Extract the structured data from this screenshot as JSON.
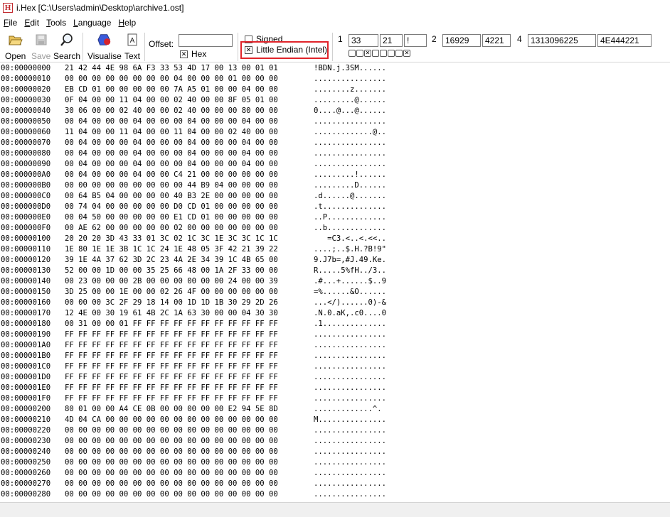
{
  "window": {
    "title": "i.Hex [C:\\Users\\admin\\Desktop\\archive1.ost]",
    "icon_letter": "H"
  },
  "menu": [
    {
      "label": "File",
      "underline": "F",
      "rest": "ile"
    },
    {
      "label": "Edit",
      "underline": "E",
      "rest": "dit"
    },
    {
      "label": "Tools",
      "underline": "T",
      "rest": "ools"
    },
    {
      "label": "Language",
      "underline": "L",
      "rest": "anguage"
    },
    {
      "label": "Help",
      "underline": "H",
      "rest": "elp"
    }
  ],
  "toolbar": {
    "open_label": "Open",
    "save_label": "Save",
    "search_label": "Search",
    "visualise_label": "Visualise",
    "text_label": "Text",
    "offset_label": "Offset:",
    "offset_value": "",
    "hex_label": "Hex",
    "hex_checked": true,
    "signed_label": "Signed",
    "signed_checked": false,
    "little_endian_label": "Little Endian (Intel)",
    "little_endian_checked": true
  },
  "inspector": {
    "group1_num": "1",
    "group1_values": [
      "33",
      "21",
      "!"
    ],
    "group2_num": "2",
    "group2_values": [
      "16929",
      "4221"
    ],
    "group4_num": "4",
    "group4_values": [
      "1313096225",
      "4E444221"
    ],
    "bits": [
      false,
      false,
      true,
      false,
      false,
      false,
      false,
      true
    ]
  },
  "colors": {
    "highlight": "#e0242a",
    "icon_red": "#c0282d"
  },
  "rows": [
    {
      "addr": "00:00000000",
      "bytes": "21 42 44 4E 98 6A F3 33 53 4D 17 00 13 00 01 01",
      "ascii": "!BDN.j.3SM......"
    },
    {
      "addr": "00:00000010",
      "bytes": "00 00 00 00 00 00 00 00 04 00 00 00 01 00 00 00",
      "ascii": "................"
    },
    {
      "addr": "00:00000020",
      "bytes": "EB CD 01 00 00 00 00 00 7A A5 01 00 00 04 00 00",
      "ascii": "........z......."
    },
    {
      "addr": "00:00000030",
      "bytes": "0F 04 00 00 11 04 00 00 02 40 00 00 8F 05 01 00",
      "ascii": ".........@......"
    },
    {
      "addr": "00:00000040",
      "bytes": "30 06 00 00 02 40 00 00 02 40 00 00 00 80 00 00",
      "ascii": "0....@...@......"
    },
    {
      "addr": "00:00000050",
      "bytes": "00 04 00 00 00 04 00 00 00 04 00 00 00 04 00 00",
      "ascii": "................"
    },
    {
      "addr": "00:00000060",
      "bytes": "11 04 00 00 11 04 00 00 11 04 00 00 02 40 00 00",
      "ascii": ".............@.."
    },
    {
      "addr": "00:00000070",
      "bytes": "00 04 00 00 00 04 00 00 00 04 00 00 00 04 00 00",
      "ascii": "................"
    },
    {
      "addr": "00:00000080",
      "bytes": "00 04 00 00 00 04 00 00 00 04 00 00 00 04 00 00",
      "ascii": "................"
    },
    {
      "addr": "00:00000090",
      "bytes": "00 04 00 00 00 04 00 00 00 04 00 00 00 04 00 00",
      "ascii": "................"
    },
    {
      "addr": "00:000000A0",
      "bytes": "00 04 00 00 00 04 00 00 C4 21 00 00 00 00 00 00",
      "ascii": ".........!......"
    },
    {
      "addr": "00:000000B0",
      "bytes": "00 00 00 00 00 00 00 00 00 44 B9 04 00 00 00 00",
      "ascii": ".........D......"
    },
    {
      "addr": "00:000000C0",
      "bytes": "00 64 B5 04 00 00 00 00 40 B3 2E 00 00 00 00 00",
      "ascii": ".d......@......."
    },
    {
      "addr": "00:000000D0",
      "bytes": "00 74 04 00 00 00 00 00 D0 CD 01 00 00 00 00 00",
      "ascii": ".t.............."
    },
    {
      "addr": "00:000000E0",
      "bytes": "00 04 50 00 00 00 00 00 E1 CD 01 00 00 00 00 00",
      "ascii": "..P............."
    },
    {
      "addr": "00:000000F0",
      "bytes": "00 AE 62 00 00 00 00 00 02 00 00 00 00 00 00 00",
      "ascii": "..b............."
    },
    {
      "addr": "00:00000100",
      "bytes": "20 20 20 3D 43 33 01 3C 02 1C 3C 1E 3C 3C 1C 1C",
      "ascii": "   =C3.<..<.<<.."
    },
    {
      "addr": "00:00000110",
      "bytes": "1E 80 1E 1E 3B 1C 1C 24 1E 48 05 3F 42 21 39 22",
      "ascii": "....;..$.H.?B!9\""
    },
    {
      "addr": "00:00000120",
      "bytes": "39 1E 4A 37 62 3D 2C 23 4A 2E 34 39 1C 4B 65 00",
      "ascii": "9.J7b=,#J.49.Ke."
    },
    {
      "addr": "00:00000130",
      "bytes": "52 00 00 1D 00 00 35 25 66 48 00 1A 2F 33 00 00",
      "ascii": "R.....5%fH../3.."
    },
    {
      "addr": "00:00000140",
      "bytes": "00 23 00 00 00 2B 00 00 00 00 00 00 24 00 00 39",
      "ascii": ".#...+......$..9"
    },
    {
      "addr": "00:00000150",
      "bytes": "3D 25 00 00 1E 00 00 02 26 4F 00 00 00 00 00 00",
      "ascii": "=%......&O......"
    },
    {
      "addr": "00:00000160",
      "bytes": "00 00 00 3C 2F 29 18 14 00 1D 1D 1B 30 29 2D 26",
      "ascii": "...</)......0)-&"
    },
    {
      "addr": "00:00000170",
      "bytes": "12 4E 00 30 19 61 4B 2C 1A 63 30 00 00 04 30 30",
      "ascii": ".N.0.aK,.c0....0"
    },
    {
      "addr": "00:00000180",
      "bytes": "00 31 00 00 01 FF FF FF FF FF FF FF FF FF FF FF",
      "ascii": ".1.............."
    },
    {
      "addr": "00:00000190",
      "bytes": "FF FF FF FF FF FF FF FF FF FF FF FF FF FF FF FF",
      "ascii": "................"
    },
    {
      "addr": "00:000001A0",
      "bytes": "FF FF FF FF FF FF FF FF FF FF FF FF FF FF FF FF",
      "ascii": "................"
    },
    {
      "addr": "00:000001B0",
      "bytes": "FF FF FF FF FF FF FF FF FF FF FF FF FF FF FF FF",
      "ascii": "................"
    },
    {
      "addr": "00:000001C0",
      "bytes": "FF FF FF FF FF FF FF FF FF FF FF FF FF FF FF FF",
      "ascii": "................"
    },
    {
      "addr": "00:000001D0",
      "bytes": "FF FF FF FF FF FF FF FF FF FF FF FF FF FF FF FF",
      "ascii": "................"
    },
    {
      "addr": "00:000001E0",
      "bytes": "FF FF FF FF FF FF FF FF FF FF FF FF FF FF FF FF",
      "ascii": "................"
    },
    {
      "addr": "00:000001F0",
      "bytes": "FF FF FF FF FF FF FF FF FF FF FF FF FF FF FF FF",
      "ascii": "................"
    },
    {
      "addr": "00:00000200",
      "bytes": "80 01 00 00 A4 CE 0B 00 00 00 00 00 E2 94 5E 8D",
      "ascii": ".............^."
    },
    {
      "addr": "00:00000210",
      "bytes": "4D 04 CA 00 00 00 00 00 00 00 00 00 00 00 00 00",
      "ascii": "M..............."
    },
    {
      "addr": "00:00000220",
      "bytes": "00 00 00 00 00 00 00 00 00 00 00 00 00 00 00 00",
      "ascii": "................"
    },
    {
      "addr": "00:00000230",
      "bytes": "00 00 00 00 00 00 00 00 00 00 00 00 00 00 00 00",
      "ascii": "................"
    },
    {
      "addr": "00:00000240",
      "bytes": "00 00 00 00 00 00 00 00 00 00 00 00 00 00 00 00",
      "ascii": "................"
    },
    {
      "addr": "00:00000250",
      "bytes": "00 00 00 00 00 00 00 00 00 00 00 00 00 00 00 00",
      "ascii": "................"
    },
    {
      "addr": "00:00000260",
      "bytes": "00 00 00 00 00 00 00 00 00 00 00 00 00 00 00 00",
      "ascii": "................"
    },
    {
      "addr": "00:00000270",
      "bytes": "00 00 00 00 00 00 00 00 00 00 00 00 00 00 00 00",
      "ascii": "................"
    },
    {
      "addr": "00:00000280",
      "bytes": "00 00 00 00 00 00 00 00 00 00 00 00 00 00 00 00",
      "ascii": "................"
    }
  ]
}
